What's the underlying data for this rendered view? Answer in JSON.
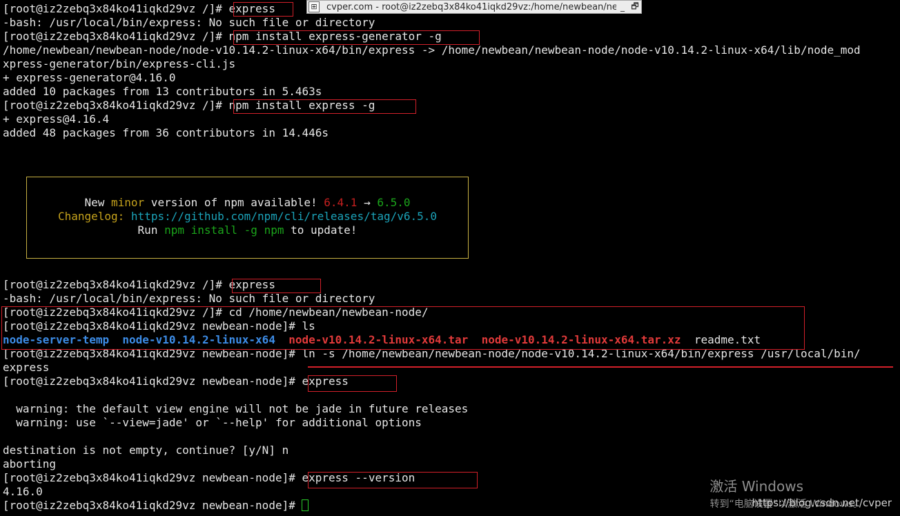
{
  "window": {
    "title": "cvper.com - root@iz2zebq3x84ko41iqkd29vz:/home/newbean/newbe",
    "pin_glyph": "⊞",
    "minimize": "_",
    "restore": "🗗"
  },
  "terminal": {
    "lines": [
      {
        "prompt": "[root@iz2zebq3x84ko41iqkd29vz /]# ",
        "cmd": "express"
      },
      {
        "text": "-bash: /usr/local/bin/express: No such file or directory"
      },
      {
        "prompt": "[root@iz2zebq3x84ko41iqkd29vz /]# ",
        "cmd": "npm install express-generator -g"
      },
      {
        "text": "/home/newbean/newbean-node/node-v10.14.2-linux-x64/bin/express -> /home/newbean/newbean-node/node-v10.14.2-linux-x64/lib/node_mod"
      },
      {
        "text": "xpress-generator/bin/express-cli.js"
      },
      {
        "text": "+ express-generator@4.16.0"
      },
      {
        "text": "added 10 packages from 13 contributors in 5.463s"
      },
      {
        "prompt": "[root@iz2zebq3x84ko41iqkd29vz /]# ",
        "cmd": "npm install express -g"
      },
      {
        "text": "+ express@4.16.4"
      },
      {
        "text": "added 48 packages from 36 contributors in 14.446s"
      }
    ],
    "npm_notice": {
      "line1_new": "New ",
      "line1_minor": "minor",
      "line1_mid": " version of npm available! ",
      "line1_old": "6.4.1",
      "line1_arrow": " → ",
      "line1_newver": "6.5.0",
      "line2_label": "Changelog: ",
      "line2_url": "https://github.com/npm/cli/releases/tag/v6.5.0",
      "line3_run": "Run ",
      "line3_cmd": "npm install -g npm",
      "line3_end": " to update!"
    },
    "lines2": [
      {
        "prompt": "[root@iz2zebq3x84ko41iqkd29vz /]# ",
        "cmd": "express"
      },
      {
        "text": "-bash: /usr/local/bin/express: No such file or directory"
      },
      {
        "prompt": "[root@iz2zebq3x84ko41iqkd29vz /]# ",
        "cmd": "cd /home/newbean/newbean-node/"
      },
      {
        "prompt": "[root@iz2zebq3x84ko41iqkd29vz newbean-node]# ",
        "cmd": "ls"
      }
    ],
    "ls_output": {
      "dir1": "node-server-temp",
      "dir2": "node-v10.14.2-linux-x64",
      "arch1": "node-v10.14.2-linux-x64.tar",
      "arch2": "node-v10.14.2-linux-x64.tar.xz",
      "file1": "readme.txt"
    },
    "lines3": [
      {
        "prompt": "[root@iz2zebq3x84ko41iqkd29vz newbean-node]# ",
        "cmd": "ln -s /home/newbean/newbean-node/node-v10.14.2-linux-x64/bin/express /usr/local/bin/"
      },
      {
        "text": "express"
      },
      {
        "prompt": "[root@iz2zebq3x84ko41iqkd29vz newbean-node]# ",
        "cmd": "express"
      },
      {
        "text": ""
      },
      {
        "text": "  warning: the default view engine will not be jade in future releases"
      },
      {
        "text": "  warning: use `--view=jade' or `--help' for additional options"
      },
      {
        "text": ""
      },
      {
        "text": "destination is not empty, continue? [y/N] n"
      },
      {
        "text": "aborting"
      },
      {
        "prompt": "[root@iz2zebq3x84ko41iqkd29vz newbean-node]# ",
        "cmd": "express --version"
      },
      {
        "text": "4.16.0"
      },
      {
        "prompt": "[root@iz2zebq3x84ko41iqkd29vz newbean-node]# ",
        "cmd": ""
      }
    ]
  },
  "watermark": {
    "title": "激活 Windows",
    "subtitle": "转到“电脑设置”以激活 Windows。",
    "url": "https://blog.csdn.net/cvper"
  },
  "colors": {
    "background": "#000000",
    "highlight_box": "#d3202a",
    "npm_box_border": "#c9b243",
    "dir_blue": "#3d8de8",
    "archive_red": "#e23a3a"
  }
}
